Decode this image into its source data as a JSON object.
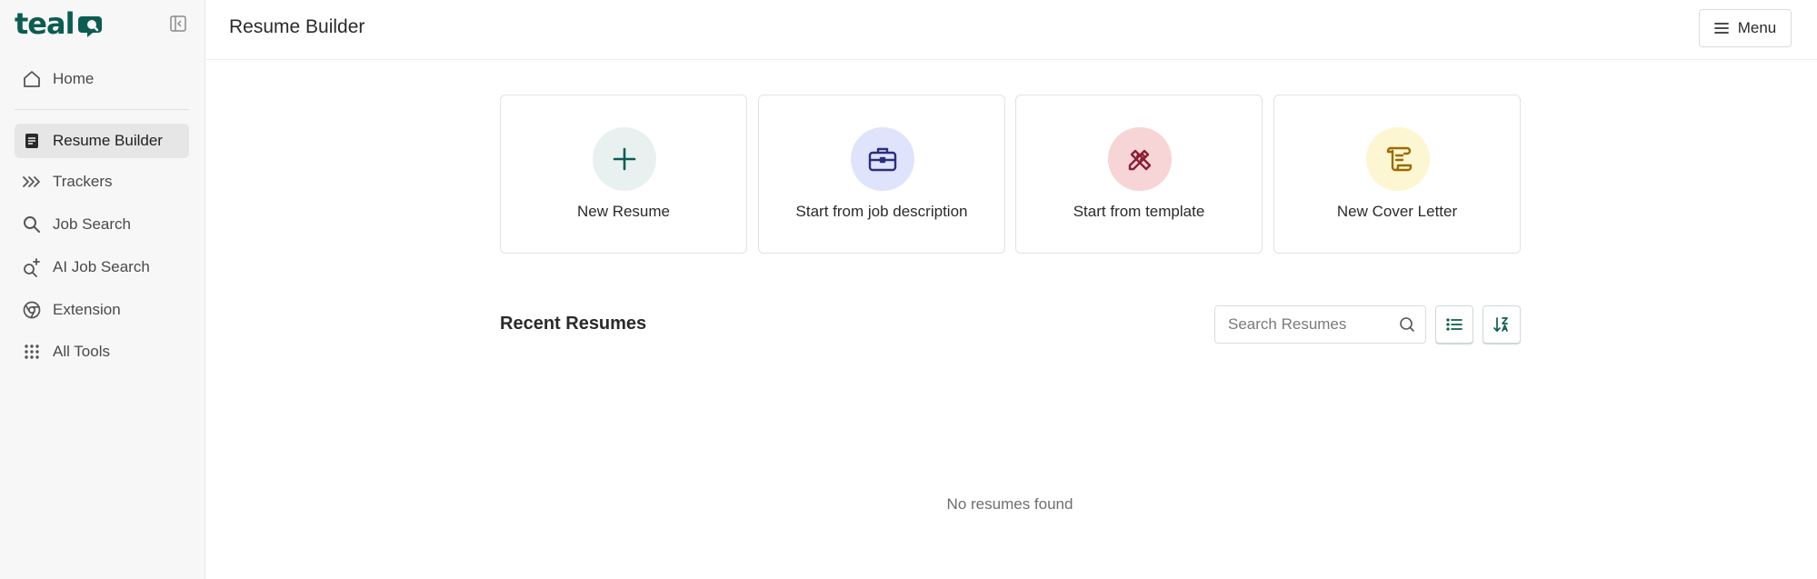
{
  "sidebar": {
    "logo_text": "teal",
    "logo_icon": "teal-logo-mark",
    "items": [
      {
        "label": "Home",
        "icon": "home-icon"
      },
      {
        "label": "Resume Builder",
        "icon": "document-icon",
        "active": true
      },
      {
        "label": "Trackers",
        "icon": "chevrons-right-icon"
      },
      {
        "label": "Job Search",
        "icon": "search-icon"
      },
      {
        "label": "AI Job Search",
        "icon": "sparkle-search-icon"
      },
      {
        "label": "Extension",
        "icon": "chrome-icon"
      },
      {
        "label": "All Tools",
        "icon": "grid-dots-icon"
      }
    ]
  },
  "header": {
    "title": "Resume Builder",
    "menu_label": "Menu"
  },
  "cards": [
    {
      "label": "New Resume",
      "icon": "plus-icon",
      "bg": "#e8f1ef",
      "fg": "#0d5c52"
    },
    {
      "label": "Start from job description",
      "icon": "briefcase-icon",
      "bg": "#dfe3fb",
      "fg": "#2a2f7a"
    },
    {
      "label": "Start from template",
      "icon": "pencil-ruler-icon",
      "bg": "#f7d4d6",
      "fg": "#8a1f35"
    },
    {
      "label": "New Cover Letter",
      "icon": "scroll-icon",
      "bg": "#fdf6d2",
      "fg": "#9a6b00"
    }
  ],
  "recent": {
    "title": "Recent Resumes",
    "search_placeholder": "Search Resumes",
    "empty_message": "No resumes found"
  },
  "colors": {
    "brand": "#0d5c52",
    "sidebar_bg": "#f7f7f7",
    "active_bg": "#e6e6e6"
  }
}
